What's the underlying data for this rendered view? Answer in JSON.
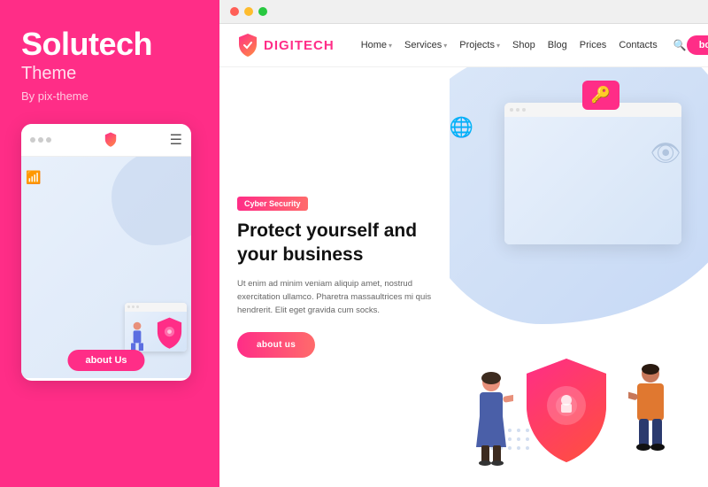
{
  "brand": {
    "title": "Solutech",
    "subtitle": "Theme",
    "by": "By pix-theme"
  },
  "mobile_preview": {
    "dots": [
      "•",
      "•",
      "•"
    ],
    "about_btn": "about Us"
  },
  "browser": {
    "dots": [
      "red",
      "yellow",
      "green"
    ]
  },
  "nav": {
    "logo_text_first": "DIGI",
    "logo_text_second": "TECH",
    "links": [
      {
        "label": "Home",
        "has_chevron": true
      },
      {
        "label": "Services",
        "has_chevron": true
      },
      {
        "label": "Projects",
        "has_chevron": true
      },
      {
        "label": "Shop",
        "has_chevron": false
      },
      {
        "label": "Blog",
        "has_chevron": false
      },
      {
        "label": "Prices",
        "has_chevron": false
      },
      {
        "label": "Contacts",
        "has_chevron": false
      }
    ],
    "booked_btn": "booked"
  },
  "hero": {
    "badge": "Cyber Security",
    "title": "Protect yourself and your business",
    "text": "Ut enim ad minim veniam aliquip amet, nostrud exercitation ullamco. Pharetra massaultrices mi quis hendrerit. Elit eget gravida cum socks.",
    "about_btn": "about us"
  },
  "colors": {
    "accent": "#ff2d87",
    "accent_gradient_end": "#ff6b6b",
    "bg_light_blue": "#dce8f8",
    "nav_bg": "#ffffff"
  }
}
